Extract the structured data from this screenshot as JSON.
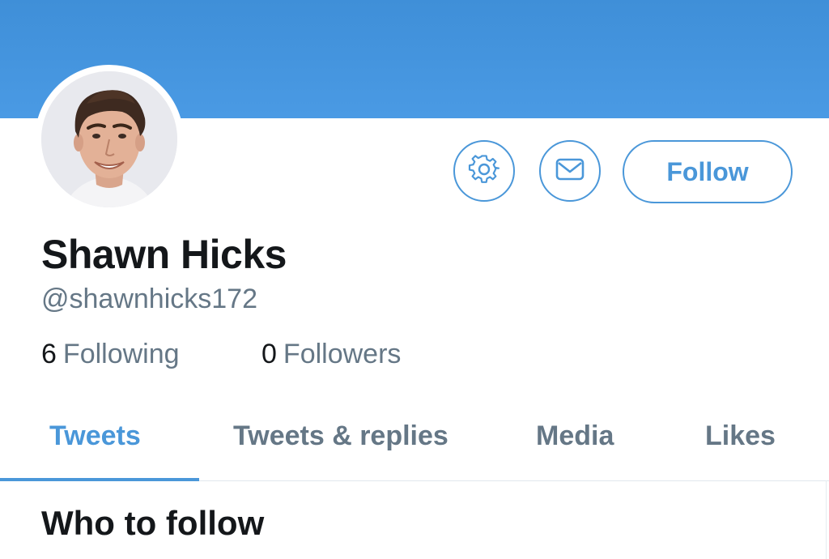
{
  "colors": {
    "accent": "#4a97d9",
    "banner": "#4a9ae4",
    "text_primary": "#14171a",
    "text_secondary": "#657786",
    "divider": "#e1e8ed"
  },
  "profile": {
    "display_name": "Shawn Hicks",
    "handle": "@shawnhicks172",
    "avatar": "profile-photo"
  },
  "actions": {
    "settings_icon": "gear-icon",
    "message_icon": "envelope-icon",
    "follow_label": "Follow"
  },
  "stats": {
    "following_count": "6",
    "following_label": "Following",
    "followers_count": "0",
    "followers_label": "Followers"
  },
  "tabs": [
    {
      "label": "Tweets",
      "active": true
    },
    {
      "label": "Tweets & replies",
      "active": false
    },
    {
      "label": "Media",
      "active": false
    },
    {
      "label": "Likes",
      "active": false
    }
  ],
  "sections": {
    "who_to_follow_title": "Who to follow"
  }
}
